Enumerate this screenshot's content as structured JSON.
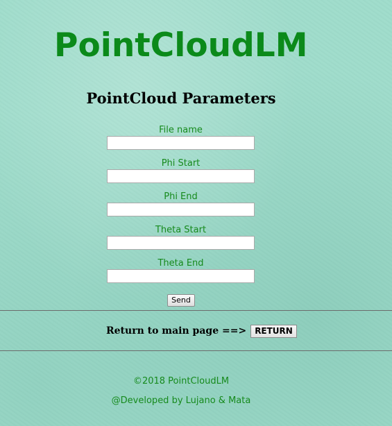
{
  "header": {
    "title": "PointCloudLM"
  },
  "form": {
    "heading": "PointCloud Parameters",
    "fields": [
      {
        "label": "File name",
        "value": ""
      },
      {
        "label": "Phi Start",
        "value": ""
      },
      {
        "label": "Phi End",
        "value": ""
      },
      {
        "label": "Theta Start",
        "value": ""
      },
      {
        "label": "Theta End",
        "value": ""
      }
    ],
    "send_label": "Send"
  },
  "return_section": {
    "label": "Return to main page ==>",
    "button_label": "RETURN"
  },
  "footer": {
    "copyright": "©2018 PointCloudLM",
    "credits": "@Developed by Lujano & Mata"
  },
  "colors": {
    "title_green": "#0b8a1a",
    "text_green": "#168a1c",
    "background": "#9fdccb"
  }
}
